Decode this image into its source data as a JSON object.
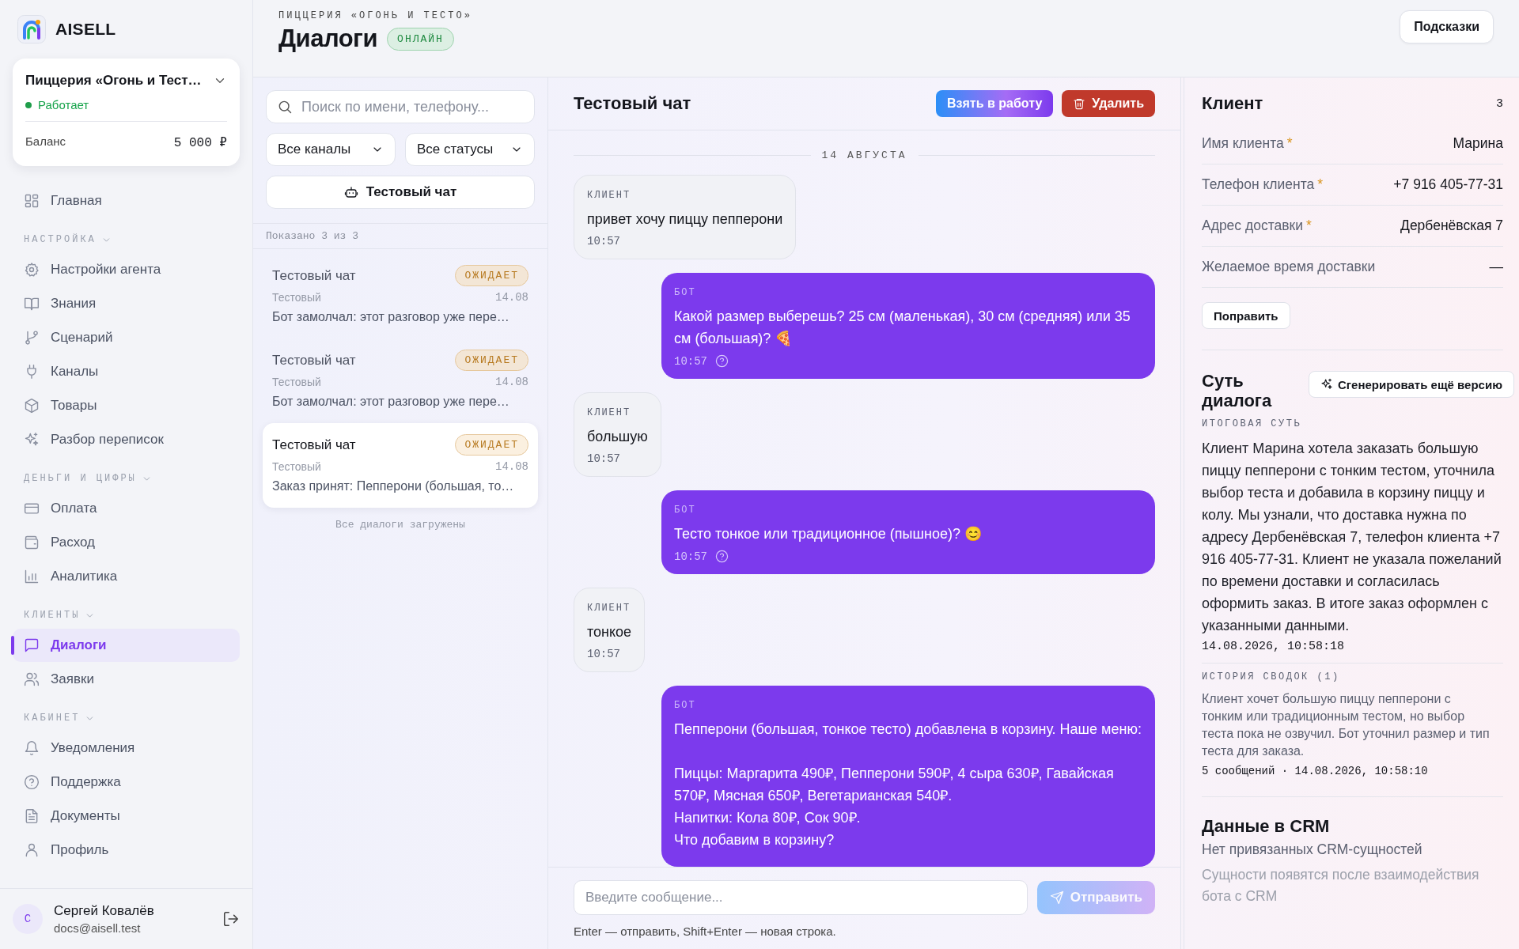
{
  "app": {
    "logo_text": "AISELL"
  },
  "org": {
    "name": "Пиццерия «Огонь и Тест…",
    "status": "Работает",
    "balance_label": "Баланс",
    "balance": "5 000 ₽"
  },
  "nav": {
    "sections": [
      {
        "items": [
          {
            "label": "Главная",
            "selected": false
          }
        ]
      },
      {
        "label": "НАСТРОЙКА",
        "items": [
          {
            "label": "Настройки агента",
            "selected": false
          },
          {
            "label": "Знания",
            "selected": false
          },
          {
            "label": "Сценарий",
            "selected": false
          },
          {
            "label": "Каналы",
            "selected": false
          },
          {
            "label": "Товары",
            "selected": false
          },
          {
            "label": "Разбор переписок",
            "selected": false
          }
        ]
      },
      {
        "label": "ДЕНЬГИ И ЦИФРЫ",
        "items": [
          {
            "label": "Оплата",
            "selected": false
          },
          {
            "label": "Расход",
            "selected": false
          },
          {
            "label": "Аналитика",
            "selected": false
          }
        ]
      },
      {
        "label": "КЛИЕНТЫ",
        "items": [
          {
            "label": "Диалоги",
            "selected": true
          },
          {
            "label": "Заявки",
            "selected": false
          }
        ]
      },
      {
        "label": "КАБИНЕТ",
        "items": [
          {
            "label": "Уведомления",
            "selected": false
          },
          {
            "label": "Поддержка",
            "selected": false
          },
          {
            "label": "Документы",
            "selected": false
          },
          {
            "label": "Профиль",
            "selected": false
          }
        ]
      }
    ]
  },
  "user": {
    "avatar": "С",
    "name": "Сергей Ковалёв",
    "email": "docs@aisell.test"
  },
  "header": {
    "subtitle": "ПИЦЦЕРИЯ «ОГОНЬ И ТЕСТО»",
    "title": "Диалоги",
    "badge": "ОНЛАЙН",
    "hints_button": "Подсказки"
  },
  "dialogs": {
    "search": {
      "placeholder": "Поиск по имени, телефону..."
    },
    "filters": [
      "Все каналы",
      "Все статусы"
    ],
    "test_chat_button": "Тестовый чат",
    "count": "Показано 3 из 3",
    "items": [
      {
        "title": "Тестовый чат",
        "status": "ОЖИДАЕТ",
        "channel": "Тестовый",
        "date": "14.08",
        "preview": "Бот замолчал: этот разговор уже пере…",
        "selected": false
      },
      {
        "title": "Тестовый чат",
        "status": "ОЖИДАЕТ",
        "channel": "Тестовый",
        "date": "14.08",
        "preview": "Бот замолчал: этот разговор уже пере…",
        "selected": false
      },
      {
        "title": "Тестовый чат",
        "status": "ОЖИДАЕТ",
        "channel": "Тестовый",
        "date": "14.08",
        "preview": "Заказ принят: Пепперони (большая, то…",
        "selected": true
      }
    ],
    "footer": "Все диалоги загружены"
  },
  "chat": {
    "title": "Тестовый чат",
    "take_button": "Взять в работу",
    "delete_button": "Удалить",
    "date": "14 АВГУСТА",
    "messages": [
      {
        "kind": "client",
        "label": "КЛИЕНТ",
        "text": "привет хочу пиццу пепперони",
        "time": "10:57"
      },
      {
        "kind": "bot",
        "label": "БОТ",
        "text": "Какой размер выберешь? 25 см (маленькая), 30 см (средняя) или 35 см (большая)? 🍕",
        "time": "10:57"
      },
      {
        "kind": "client",
        "label": "КЛИЕНТ",
        "text": "большую",
        "time": "10:57"
      },
      {
        "kind": "bot",
        "label": "БОТ",
        "text": "Тесто тонкое или традиционное (пышное)? 😊",
        "time": "10:57"
      },
      {
        "kind": "client",
        "label": "КЛИЕНТ",
        "text": "тонкое",
        "time": "10:57"
      },
      {
        "kind": "bot",
        "label": "БОТ",
        "text": "Пепперони (большая, тонкое тесто) добавлена в корзину. Наше меню:\n\nПиццы: Маргарита 490₽, Пепперони 590₽, 4 сыра 630₽, Гавайская 570₽, Мясная 650₽, Вегетарианская 540₽.\nНапитки: Кола 80₽, Сок 90₽.\nЧто добавим в корзину?"
      }
    ],
    "composer": {
      "placeholder": "Введите сообщение...",
      "send_button": "Отправить",
      "send_disabled": true,
      "hint": "Enter — отправить, Shift+Enter — новая строка."
    }
  },
  "client": {
    "title": "Клиент",
    "count": "3",
    "fields": [
      {
        "label": "Имя клиента",
        "mark": "*",
        "value": "Марина"
      },
      {
        "label": "Телефон клиента",
        "mark": "*",
        "value": "+7 916 405-77-31"
      },
      {
        "label": "Адрес доставки",
        "mark": "*",
        "value": "Дербенёвская 7"
      },
      {
        "label": "Желаемое время доставки",
        "value": "—"
      }
    ],
    "edit_button": "Поправить",
    "summary": {
      "title": "Суть диалога",
      "generate_button": "Сгенерировать ещё версию",
      "label": "ИТОГОВАЯ СУТЬ",
      "text": "Клиент Марина хотела заказать большую пиццу пепперони с тонким тестом, уточнила выбор теста и добавила в корзину пиццу и колу. Мы узнали, что доставка нужна по адресу Дербенёвская 7, телефон клиента +7 916 405-77-31. Клиент не указала пожеланий по времени доставки и согласилась оформить заказ. В итоге заказ оформлен с указанными данными.",
      "timestamp": "14.08.2026, 10:58:18",
      "history_label": "ИСТОРИЯ СВОДОК (1)",
      "history_text": "Клиент хочет большую пиццу пепперони с тонким или традиционным тестом, но выбор теста пока не озвучил. Бот уточнил размер и тип теста для заказа.",
      "history_meta": "5 сообщений · 14.08.2026, 10:58:10"
    },
    "crm": {
      "title": "Данные в CRM",
      "text": "Нет привязанных CRM-сущностей",
      "hint": "Сущности появятся после взаимодействия бота с CRM"
    }
  }
}
